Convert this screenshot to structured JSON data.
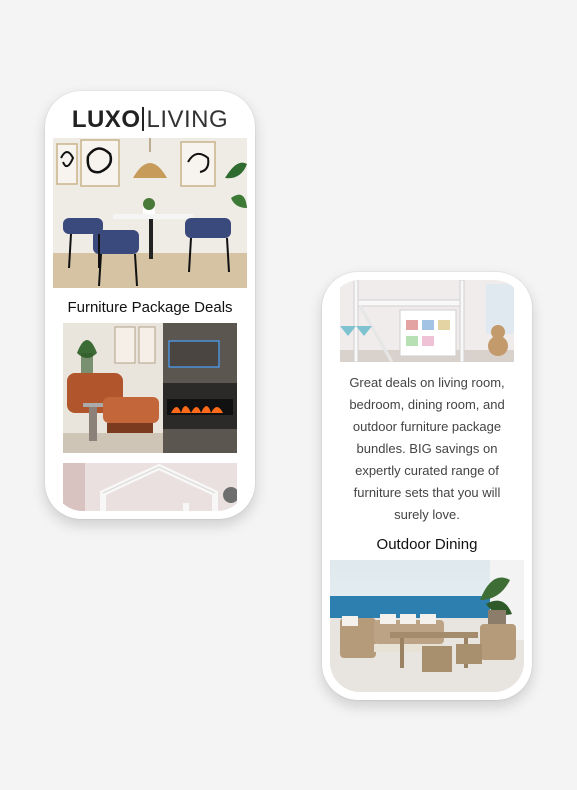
{
  "brand": {
    "logo_bold": "LUXO",
    "logo_light": "LIVING"
  },
  "left_phone": {
    "section_title": "Furniture Package Deals",
    "images": [
      "dining-room-photo",
      "living-room-fireplace-photo",
      "kids-bed-photo"
    ]
  },
  "right_phone": {
    "description": "Great deals on living room, bedroom, dining room, and outdoor furniture package bundles.  BIG savings on expertly curated range of furniture sets that you will surely love.",
    "section_title": "Outdoor Dining",
    "images": [
      "loft-bed-photo",
      "outdoor-dining-photo"
    ]
  },
  "colors": {
    "background": "#f4f4f4",
    "phone": "#ffffff",
    "text": "#111111"
  }
}
